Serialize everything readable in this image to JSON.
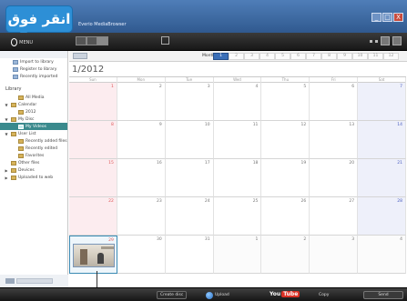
{
  "window": {
    "title": "Everio MediaBrowser",
    "buttons": {
      "minimize": "_",
      "maximize": "□",
      "close": "X"
    }
  },
  "callout": {
    "text": "انقر فوق"
  },
  "toolbar": {
    "menu_label": "MENU"
  },
  "sidebar": {
    "top_items": [
      "Import to library",
      "Register to library",
      "Recently imported"
    ],
    "library_heading": "Library",
    "tree": [
      {
        "label": "All Media",
        "level": 1,
        "arrow": ""
      },
      {
        "label": "Calendar",
        "level": 0,
        "arrow": "▼"
      },
      {
        "label": "2012",
        "level": 1,
        "arrow": ""
      },
      {
        "label": "My Disc",
        "level": 0,
        "arrow": "▼"
      },
      {
        "label": "My Videos",
        "level": 1,
        "arrow": "",
        "selected": true
      },
      {
        "label": "User List",
        "level": 0,
        "arrow": "▼"
      },
      {
        "label": "Recently added files",
        "level": 1,
        "arrow": ""
      },
      {
        "label": "Recently edited",
        "level": 1,
        "arrow": ""
      },
      {
        "label": "Favorites",
        "level": 1,
        "arrow": ""
      },
      {
        "label": "Other files",
        "level": 0,
        "arrow": ""
      },
      {
        "label": "Devices",
        "level": 0,
        "arrow": "▶"
      },
      {
        "label": "Uploaded to web",
        "level": 0,
        "arrow": "▶"
      }
    ]
  },
  "calendar": {
    "month_title": "1/2012",
    "nav_label": "Month",
    "months": [
      "1",
      "2",
      "3",
      "4",
      "5",
      "6",
      "7",
      "8",
      "9",
      "10",
      "11",
      "12"
    ],
    "active_month": "1",
    "weekdays": [
      "Sun",
      "Mon",
      "Tue",
      "Wed",
      "Thu",
      "Fri",
      "Sat"
    ],
    "weeks": [
      [
        "1",
        "2",
        "3",
        "4",
        "5",
        "6",
        "7"
      ],
      [
        "8",
        "9",
        "10",
        "11",
        "12",
        "13",
        "14"
      ],
      [
        "15",
        "16",
        "17",
        "18",
        "19",
        "20",
        "21"
      ],
      [
        "22",
        "23",
        "24",
        "25",
        "26",
        "27",
        "28"
      ],
      [
        "29",
        "30",
        "31",
        "1",
        "2",
        "3",
        "4"
      ]
    ],
    "selected_day": "29"
  },
  "bottombar": {
    "create_disc": "Create disc",
    "upload_web": "Upload",
    "youtube_you": "You",
    "youtube_tube": "Tube",
    "copy": "Copy",
    "right_button": "Send"
  },
  "colors": {
    "accent": "#3b6fb7",
    "selection": "#3a8a8d",
    "callout": "#2d8fd6",
    "sunday_bg": "#fcecef",
    "saturday_bg": "#eef0fa"
  }
}
